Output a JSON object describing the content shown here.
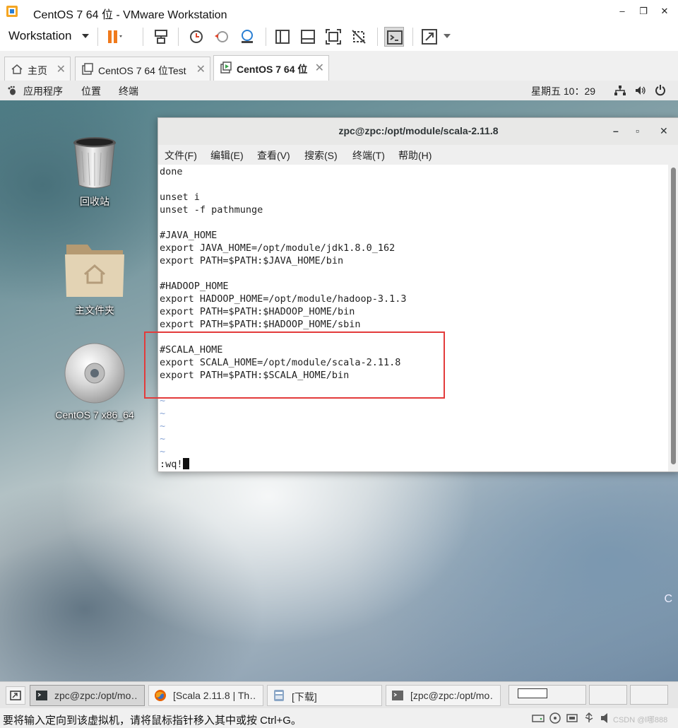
{
  "window": {
    "title": "CentOS 7 64 位 - VMware Workstation",
    "minimize": "–",
    "restore": "❐",
    "close": "✕"
  },
  "toolbar": {
    "workstation_label": "Workstation"
  },
  "tabs": [
    {
      "label": "主页",
      "icon": "home-icon",
      "close": "✕"
    },
    {
      "label": "CentOS 7 64 位Test",
      "icon": "vm-icon",
      "close": "✕"
    },
    {
      "label": "CentOS 7 64 位",
      "icon": "vm-running-icon",
      "close": "✕"
    }
  ],
  "gnome_bar": {
    "applications": "应用程序",
    "places": "位置",
    "terminal": "终端",
    "clock": "星期五 10：29"
  },
  "desktop": {
    "icons": [
      {
        "label": "回收站",
        "icon": "trash-icon"
      },
      {
        "label": "主文件夹",
        "icon": "home-folder-icon"
      },
      {
        "label": "CentOS 7 x86_64",
        "icon": "disc-icon"
      }
    ],
    "edge_char": "C"
  },
  "terminal": {
    "title": "zpc@zpc:/opt/module/scala-2.11.8",
    "buttons": {
      "minimize": "–",
      "maximize": "▫",
      "close": "✕"
    },
    "menus": [
      "文件(F)",
      "编辑(E)",
      "查看(V)",
      "搜索(S)",
      "终端(T)",
      "帮助(H)"
    ],
    "lines": [
      "done",
      "",
      "unset i",
      "unset -f pathmunge",
      "",
      "#JAVA_HOME",
      "export JAVA_HOME=/opt/module/jdk1.8.0_162",
      "export PATH=$PATH:$JAVA_HOME/bin",
      "",
      "#HADOOP_HOME",
      "export HADOOP_HOME=/opt/module/hadoop-3.1.3",
      "export PATH=$PATH:$HADOOP_HOME/bin",
      "export PATH=$PATH:$HADOOP_HOME/sbin",
      "",
      "#SCALA_HOME",
      "export SCALA_HOME=/opt/module/scala-2.11.8",
      "export PATH=$PATH:$SCALA_HOME/bin",
      "",
      "~",
      "~",
      "~",
      "~",
      "~"
    ],
    "command": ":wq!"
  },
  "taskbar": {
    "items": [
      {
        "label": "zpc@zpc:/opt/mo…",
        "icon": "terminal-icon",
        "active": true
      },
      {
        "label": "[Scala 2.11.8 | Th…",
        "icon": "firefox-icon",
        "active": false
      },
      {
        "label": "[下载]",
        "icon": "file-manager-icon",
        "active": false
      },
      {
        "label": "[zpc@zpc:/opt/mo…",
        "icon": "terminal-icon",
        "active": false
      }
    ]
  },
  "statusbar": {
    "text": "要将输入定向到该虚拟机，请将鼠标指针移入其中或按 Ctrl+G。",
    "watermark": "CSDN @l哪888"
  }
}
